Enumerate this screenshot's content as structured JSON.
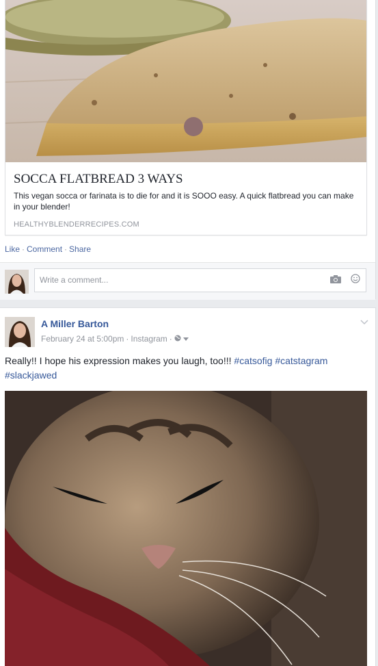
{
  "link_card": {
    "title": "SOCCA FLATBREAD 3 WAYS",
    "description": "This vegan socca or farinata is to die for and it is SOOO easy. A quick flatbread you can make in your blender!",
    "domain": "HEALTHYBLENDERRECIPES.COM",
    "image_icon": "flatbread-photo"
  },
  "actions": {
    "like": "Like",
    "comment": "Comment",
    "share": "Share",
    "separator": "·"
  },
  "comment_box": {
    "placeholder": "Write a comment...",
    "camera_icon": "camera-icon",
    "emoji_icon": "emoji-icon"
  },
  "post": {
    "author": "A Miller Barton",
    "date": "February 24 at 5:00pm",
    "via": "Instagram",
    "text_plain": "Really!! I hope his expression makes you laugh, too!!! ",
    "tags": [
      "#catsofig",
      "#catstagram",
      "#slackjawed"
    ],
    "image_icon": "cat-photo"
  },
  "colors": {
    "link_blue": "#365899",
    "meta_gray": "#90949c",
    "background": "#e9ebee"
  }
}
